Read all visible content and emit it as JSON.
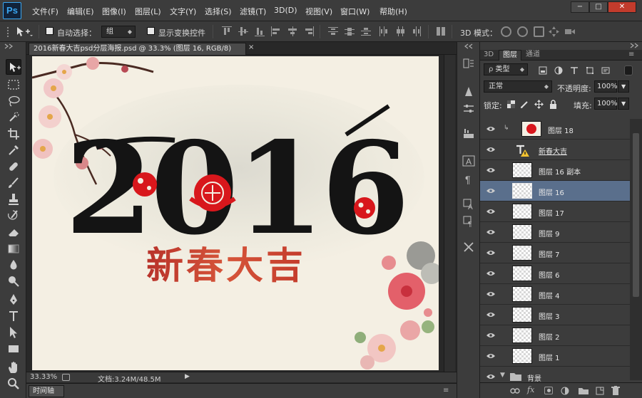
{
  "app": {
    "logo": "Ps"
  },
  "menu": [
    "文件(F)",
    "编辑(E)",
    "图像(I)",
    "图层(L)",
    "文字(Y)",
    "选择(S)",
    "滤镜(T)",
    "3D(D)",
    "视图(V)",
    "窗口(W)",
    "帮助(H)"
  ],
  "window_controls": {
    "minimize": "−",
    "restore": "□",
    "close": "✕"
  },
  "options": {
    "auto_select_label": "自动选择：",
    "auto_select_value": "组",
    "show_transform_label": "显示变换控件",
    "mode_3d_label": "3D 模式："
  },
  "document": {
    "tab_title": "2016新春大吉psd分层海报.psd @ 33.3% (图层 16, RGB/8)",
    "tab_close": "×",
    "zoom": "33.33%",
    "doc_size": "文档:3.24M/48.5M"
  },
  "artwork": {
    "big_numbers": "2016",
    "subtitle": "新春大吉"
  },
  "timeline_tab": "时间轴",
  "panel": {
    "tabs": [
      "3D",
      "图层",
      "通道"
    ],
    "active_tab": "图层",
    "filter_label": "类型",
    "blend_mode": "正常",
    "opacity_label": "不透明度:",
    "opacity_value": "100%",
    "lock_label": "锁定:",
    "fill_label": "填充:",
    "fill_value": "100%"
  },
  "layers": [
    {
      "name": "图层 18",
      "thumb": "red",
      "selected": false
    },
    {
      "name": "新春大吉",
      "thumb": "text",
      "selected": false
    },
    {
      "name": "图层 16 副本",
      "thumb": "checker",
      "selected": false
    },
    {
      "name": "图层 16",
      "thumb": "checker",
      "selected": true
    },
    {
      "name": "图层 17",
      "thumb": "checker",
      "selected": false
    },
    {
      "name": "图层 9",
      "thumb": "checker",
      "selected": false
    },
    {
      "name": "图层 7",
      "thumb": "checker",
      "selected": false
    },
    {
      "name": "图层 6",
      "thumb": "checker",
      "selected": false
    },
    {
      "name": "图层 4",
      "thumb": "checker",
      "selected": false
    },
    {
      "name": "图层 3",
      "thumb": "checker",
      "selected": false
    },
    {
      "name": "图层 2",
      "thumb": "checker",
      "selected": false
    },
    {
      "name": "图层 1",
      "thumb": "checker",
      "selected": false
    },
    {
      "name": "背景",
      "thumb": "group",
      "selected": false
    }
  ],
  "colors": {
    "accent": "#3aa6f0",
    "selection": "#5a6f8c",
    "canvas_bg": "#f4efe3",
    "ink": "#141414",
    "paper_cut_red": "#d8171c"
  }
}
